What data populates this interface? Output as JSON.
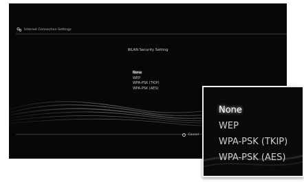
{
  "header": {
    "title": "Internet Connection Settings",
    "icon": "network-settings-icon"
  },
  "dialog": {
    "title": "WLAN Security Setting",
    "options": [
      {
        "label": "None",
        "selected": true
      },
      {
        "label": "WEP",
        "selected": false
      },
      {
        "label": "WPA-PSK (TKIP)",
        "selected": false
      },
      {
        "label": "WPA-PSK (AES)",
        "selected": false
      }
    ]
  },
  "footer": {
    "cancel_label": "Cancel",
    "cancel_icon": "circle-button-icon"
  },
  "colors": {
    "screen_bg": "#070707",
    "text": "#c9c9c9",
    "highlight": "#ffffff",
    "zoom_border": "#f2f2f2"
  }
}
